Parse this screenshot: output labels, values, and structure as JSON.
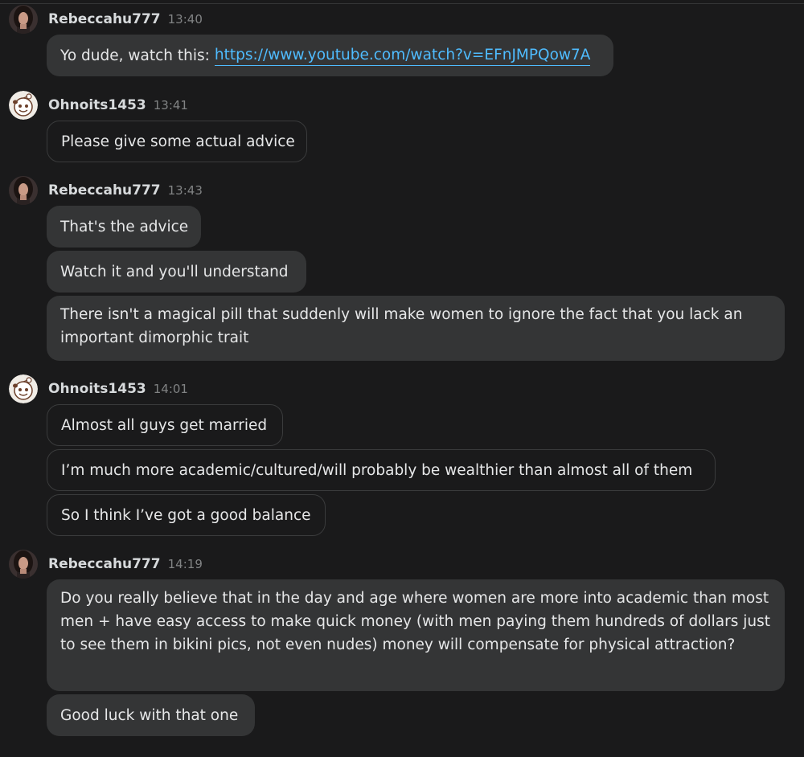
{
  "groups": [
    {
      "username": "Rebeccahu777",
      "time": "13:40",
      "avatar": "woman-avatar-icon",
      "messages": [
        {
          "text": "Yo dude, watch this:",
          "link": "https://www.youtube.com/watch?v=EFnJMPQow7A"
        }
      ]
    },
    {
      "username": "Ohnoits1453",
      "time": "13:41",
      "avatar": "snoo-avatar-icon",
      "messages": [
        {
          "text": "Please give some actual advice"
        }
      ]
    },
    {
      "username": "Rebeccahu777",
      "time": "13:43",
      "avatar": "woman-avatar-icon",
      "messages": [
        {
          "text": "That's the advice"
        },
        {
          "text": "Watch it and you'll understand"
        },
        {
          "text": "There isn't a magical pill that suddenly will make women to ignore the fact that you lack an important dimorphic trait"
        }
      ]
    },
    {
      "username": "Ohnoits1453",
      "time": "14:01",
      "avatar": "snoo-avatar-icon",
      "messages": [
        {
          "text": "Almost all guys get married"
        },
        {
          "text": "I’m much more academic/cultured/will probably be wealthier than almost all of them"
        },
        {
          "text": "So I think I’ve got a good balance"
        }
      ]
    },
    {
      "username": "Rebeccahu777",
      "time": "14:19",
      "avatar": "woman-avatar-icon",
      "messages": [
        {
          "text": "Do you really believe that in the day and age where women are more into academic than most men + have easy access to make quick money (with men paying them hundreds of dollars just to see them in bikini pics, not even nudes) money will compensate for physical attraction?"
        },
        {
          "text": "Good luck with that one"
        }
      ]
    }
  ],
  "colors": {
    "background": "#1a1a1b",
    "bubble": "#343536",
    "link": "#4fbcff",
    "timestamp": "#818384"
  }
}
